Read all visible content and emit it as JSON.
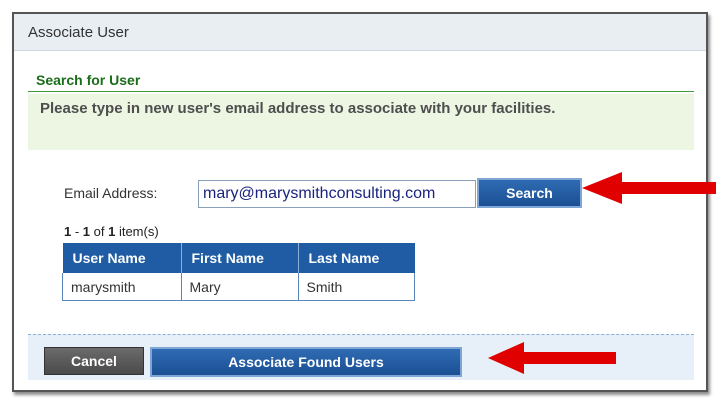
{
  "dialog": {
    "title": "Associate User",
    "section_title": "Search for User",
    "instruction": "Please type in new user's email address to associate with your facilities."
  },
  "search": {
    "label": "Email Address:",
    "value": "mary@marysmithconsulting.com",
    "button_label": "Search"
  },
  "results": {
    "range_start": "1",
    "range_sep": " - ",
    "range_end": "1",
    "of_text": " of ",
    "total": "1",
    "suffix": " item(s)",
    "columns": [
      "User Name",
      "First Name",
      "Last Name"
    ],
    "rows": [
      [
        "marysmith",
        "Mary",
        "Smith"
      ]
    ]
  },
  "footer": {
    "cancel_label": "Cancel",
    "associate_label": "Associate Found Users"
  },
  "colors": {
    "arrow": "#e00000",
    "header_green": "#1a6e1a",
    "button_blue": "#1f5ca3"
  }
}
